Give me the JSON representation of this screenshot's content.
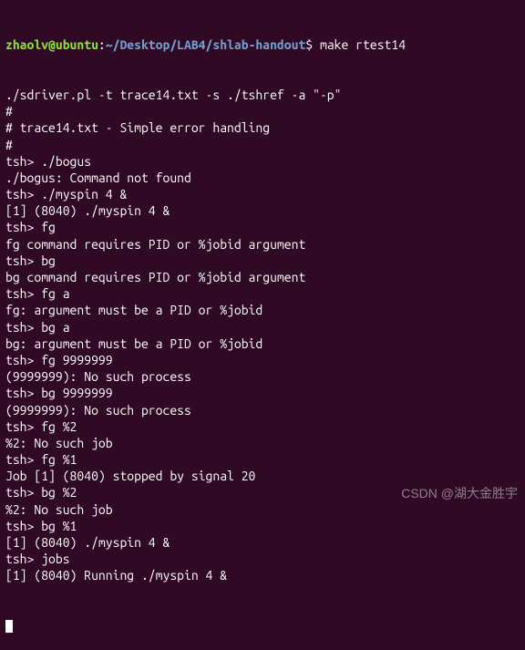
{
  "prompt": {
    "userhost": "zhaolv@ubuntu",
    "colon": ":",
    "path": "~/Desktop/LAB4/shlab-handout",
    "dollar": "$ "
  },
  "command": "make rtest14",
  "lines": [
    "./sdriver.pl -t trace14.txt -s ./tshref -a \"-p\"",
    "#",
    "# trace14.txt - Simple error handling",
    "#",
    "tsh> ./bogus",
    "./bogus: Command not found",
    "tsh> ./myspin 4 &",
    "[1] (8040) ./myspin 4 &",
    "tsh> fg",
    "fg command requires PID or %jobid argument",
    "tsh> bg",
    "bg command requires PID or %jobid argument",
    "tsh> fg a",
    "fg: argument must be a PID or %jobid",
    "tsh> bg a",
    "bg: argument must be a PID or %jobid",
    "tsh> fg 9999999",
    "(9999999): No such process",
    "tsh> bg 9999999",
    "(9999999): No such process",
    "tsh> fg %2",
    "%2: No such job",
    "tsh> fg %1",
    "Job [1] (8040) stopped by signal 20",
    "tsh> bg %2",
    "%2: No such job",
    "tsh> bg %1",
    "[1] (8040) ./myspin 4 &",
    "tsh> jobs",
    "[1] (8040) Running ./myspin 4 &"
  ],
  "watermark": "CSDN @湖大金胜宇"
}
